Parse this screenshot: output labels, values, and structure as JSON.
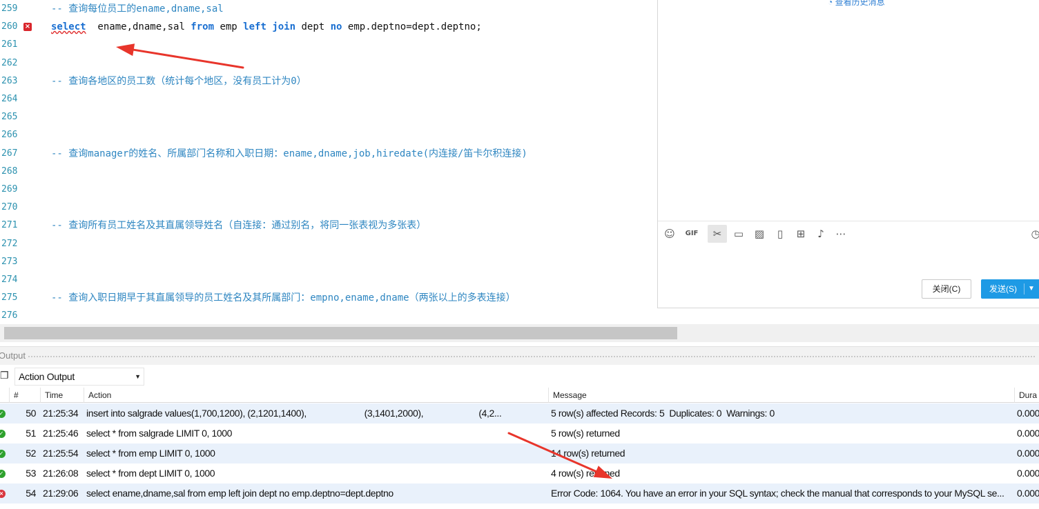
{
  "editor": {
    "lines": [
      {
        "num": "259",
        "segments": [
          {
            "t": "-- 查询每位员工的ename,dname,sal",
            "c": "cmt"
          }
        ]
      },
      {
        "num": "260",
        "error": true,
        "segments": [
          {
            "t": "select",
            "c": "kw-err"
          },
          {
            "t": "  ename,dname,sal ",
            "c": "id"
          },
          {
            "t": "from",
            "c": "kw"
          },
          {
            "t": " emp ",
            "c": "id"
          },
          {
            "t": "left",
            "c": "kw"
          },
          {
            "t": " ",
            "c": "id"
          },
          {
            "t": "join",
            "c": "kw"
          },
          {
            "t": " dept ",
            "c": "id"
          },
          {
            "t": "no",
            "c": "kw"
          },
          {
            "t": " emp.deptno=dept.deptno;",
            "c": "id"
          }
        ]
      },
      {
        "num": "261",
        "segments": []
      },
      {
        "num": "262",
        "segments": []
      },
      {
        "num": "263",
        "segments": [
          {
            "t": "-- 查询各地区的员工数（统计每个地区，没有员工计为0）",
            "c": "cmt"
          }
        ]
      },
      {
        "num": "264",
        "segments": []
      },
      {
        "num": "265",
        "segments": []
      },
      {
        "num": "266",
        "segments": []
      },
      {
        "num": "267",
        "segments": [
          {
            "t": "-- 查询manager的姓名、所属部门名称和入职日期：ename,dname,job,hiredate(内连接/笛卡尔积连接)",
            "c": "cmt"
          }
        ]
      },
      {
        "num": "268",
        "segments": []
      },
      {
        "num": "269",
        "segments": []
      },
      {
        "num": "270",
        "segments": []
      },
      {
        "num": "271",
        "segments": [
          {
            "t": "-- 查询所有员工姓名及其直属领导姓名（自连接：通过别名，将同一张表视为多张表）",
            "c": "cmt"
          }
        ]
      },
      {
        "num": "272",
        "segments": []
      },
      {
        "num": "273",
        "segments": []
      },
      {
        "num": "274",
        "segments": []
      },
      {
        "num": "275",
        "segments": [
          {
            "t": "-- 查询入职日期早于其直属领导的员工姓名及其所属部门：empno,ename,dname（两张以上的多表连接）",
            "c": "cmt"
          }
        ]
      },
      {
        "num": "276",
        "segments": []
      }
    ],
    "error_marker": "×"
  },
  "chat": {
    "history_link": "查看历史消息",
    "toolbar_icons": [
      "emoji-icon",
      "gif-icon",
      "scissors-icon",
      "folder-icon",
      "image-icon",
      "shake-icon",
      "red-packet-icon",
      "music-icon",
      "more-icon",
      "clock-icon"
    ],
    "close_label": "关闭(C)",
    "send_label": "发送(S)"
  },
  "output": {
    "title": "Output",
    "selector_value": "Action Output",
    "columns": [
      "#",
      "Time",
      "Action",
      "Message",
      "Dura"
    ],
    "rows": [
      {
        "status": "ok",
        "num": "50",
        "time": "21:25:34",
        "action": "insert into salgrade values(1,700,1200), (2,1201,1400),                        (3,1401,2000),                       (4,2...",
        "message": "5 row(s) affected Records: 5  Duplicates: 0  Warnings: 0",
        "duration": "0.000"
      },
      {
        "status": "ok",
        "num": "51",
        "time": "21:25:46",
        "action": "select * from salgrade LIMIT 0, 1000",
        "message": "5 row(s) returned",
        "duration": "0.000"
      },
      {
        "status": "ok",
        "num": "52",
        "time": "21:25:54",
        "action": "select * from emp LIMIT 0, 1000",
        "message": "14 row(s) returned",
        "duration": "0.000"
      },
      {
        "status": "ok",
        "num": "53",
        "time": "21:26:08",
        "action": "select * from dept LIMIT 0, 1000",
        "message": "4 row(s) returned",
        "duration": "0.000"
      },
      {
        "status": "err",
        "num": "54",
        "time": "21:29:06",
        "action": "select ename,dname,sal from emp left join dept no emp.deptno=dept.deptno",
        "message": "Error Code: 1064. You have an error in your SQL syntax; check the manual that corresponds to your MySQL se...",
        "duration": "0.000"
      }
    ]
  },
  "colors": {
    "comment": "#2e86c1",
    "keyword": "#1a6fd1",
    "error": "#d9262c",
    "success": "#2ea12e",
    "send_button": "#1e9ae5",
    "row_alt": "#e9f1fb",
    "annotation_arrow": "#e8352b"
  }
}
